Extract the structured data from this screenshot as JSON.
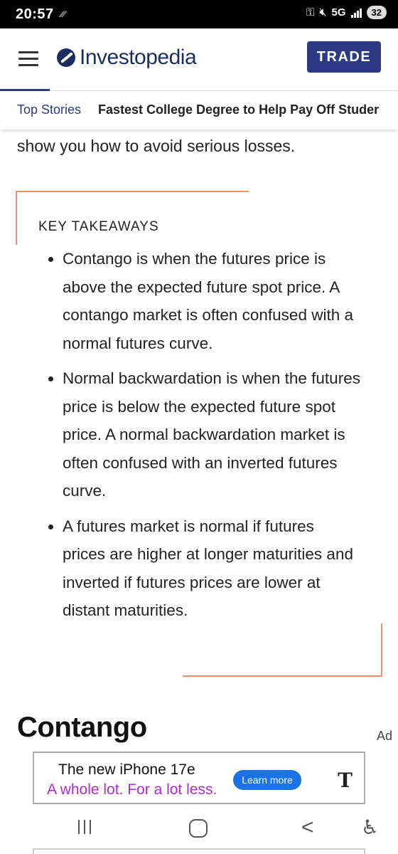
{
  "status_bar": {
    "time": "20:57",
    "network": "5G",
    "battery": "32"
  },
  "header": {
    "logo_text": "Investopedia",
    "trade_label": "TRADE"
  },
  "ticker": {
    "label": "Top Stories",
    "headline": "Fastest College Degree to Help Pay Off Studer"
  },
  "article": {
    "lead_text": "show you how to avoid serious losses.",
    "key_takeaways": {
      "title": "KEY TAKEAWAYS",
      "items": [
        "Contango is when the futures price is above the expected future spot price. A contango market is often confused with a normal futures curve.",
        "Normal backwardation is when the futures price is below the expected future spot price. A normal backwardation market is often confused with an inverted futures curve.",
        "A futures market is normal if futures prices are higher at longer maturities and inverted if futures prices are lower at distant maturities."
      ]
    },
    "section_heading": "Contango",
    "ad_label": "Ad"
  },
  "ad_banner": {
    "line1": "The new  iPhone 17e",
    "line2": "A whole lot. For a lot less.",
    "cta": "Learn more",
    "brand": "T"
  },
  "colors": {
    "brand_navy": "#1b2f5e",
    "trade_button": "#2b3a82",
    "takeaway_border": "#e8916a",
    "ad_purple": "#b02bd1",
    "ad_cta_blue": "#1c73e8"
  },
  "icons": {
    "menu": "hamburger-menu-icon",
    "recents": "recents-icon",
    "home": "home-icon",
    "back": "back-icon",
    "accessibility": "accessibility-icon"
  }
}
